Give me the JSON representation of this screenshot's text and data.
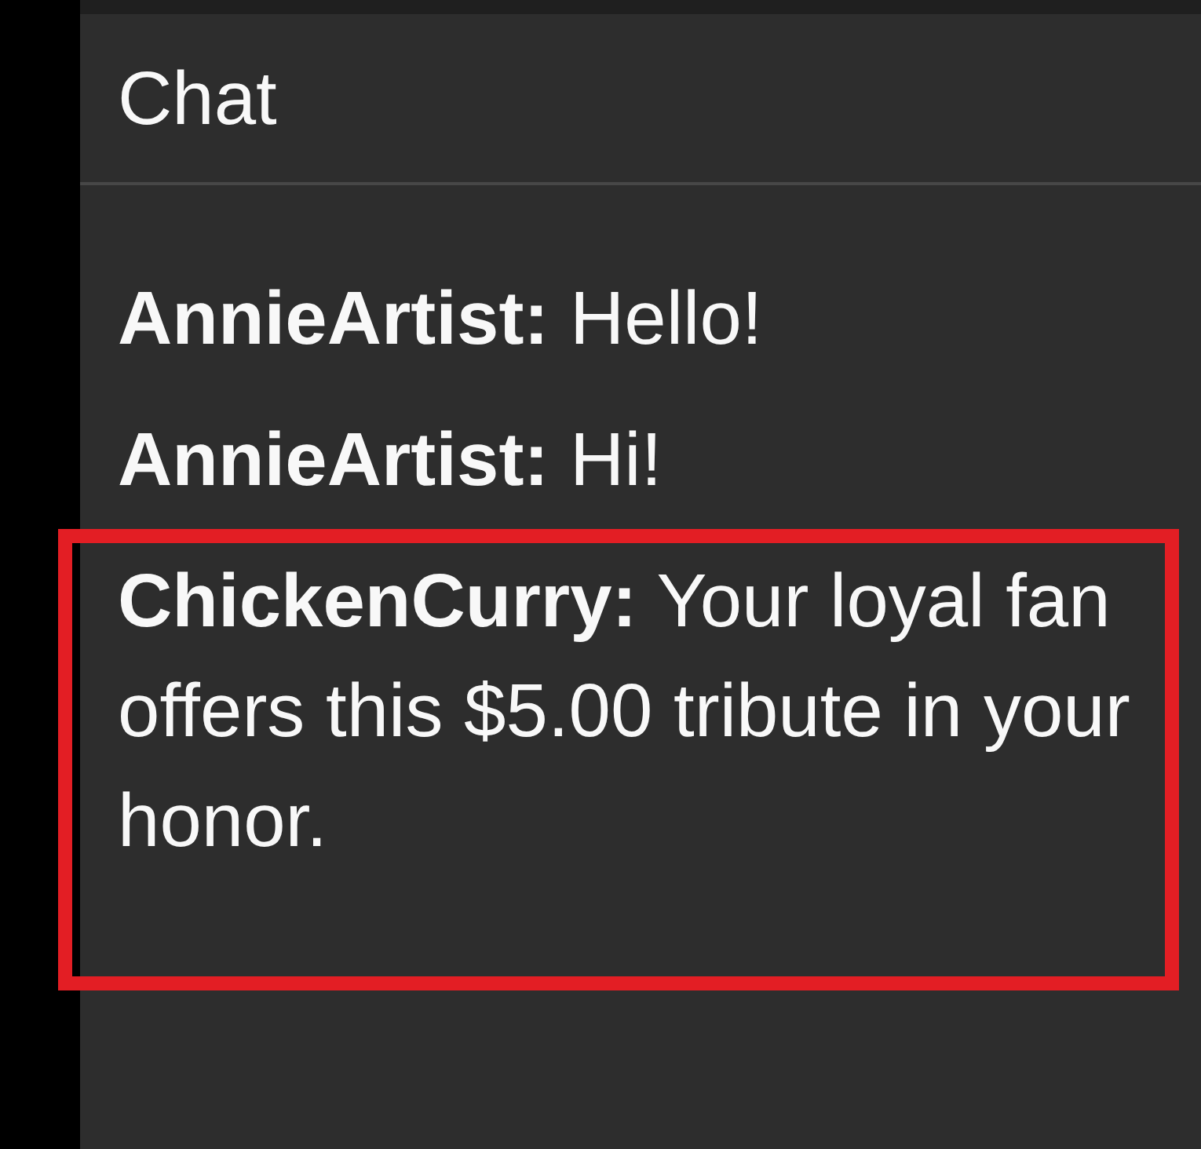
{
  "header": {
    "title": "Chat"
  },
  "messages": [
    {
      "text": "**AnnieArtist:** Hello!",
      "highlighted": false
    },
    {
      "text": "**AnnieArtist:** Hi!",
      "highlighted": false
    },
    {
      "text": "**ChickenCurry:** Your loyal fan offers this $5.00 tribute in your honor.",
      "highlighted": true
    }
  ]
}
